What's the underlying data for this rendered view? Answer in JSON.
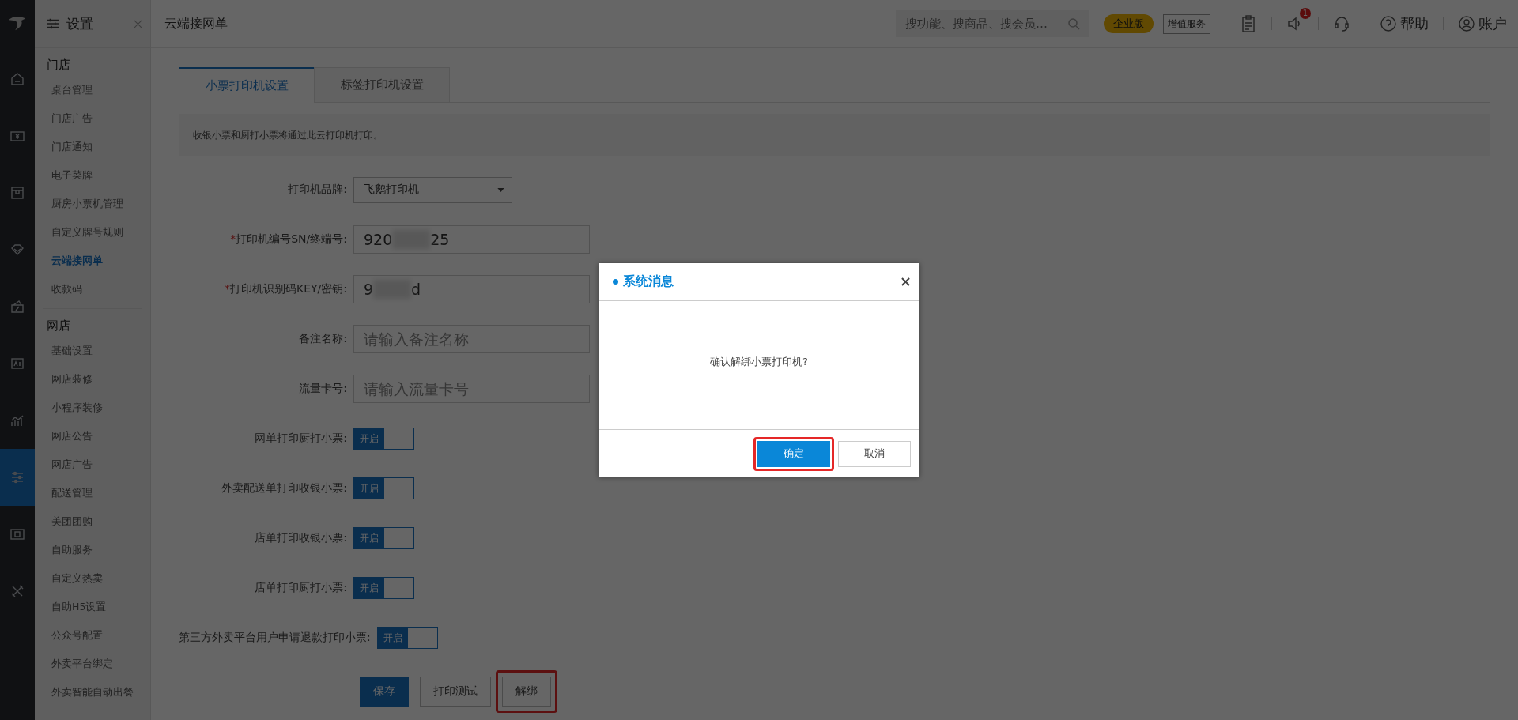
{
  "rail": [
    {
      "selected": false
    },
    {
      "selected": false
    },
    {
      "selected": false
    },
    {
      "selected": false
    },
    {
      "selected": false
    },
    {
      "selected": false
    },
    {
      "selected": false
    },
    {
      "selected": true
    },
    {
      "selected": false
    },
    {
      "selected": false
    }
  ],
  "sidebar": {
    "title": "设置",
    "groups": [
      {
        "name": "门店",
        "items": [
          {
            "label": "桌台管理",
            "selected": false
          },
          {
            "label": "门店广告",
            "selected": false
          },
          {
            "label": "门店通知",
            "selected": false
          },
          {
            "label": "电子菜牌",
            "selected": false
          },
          {
            "label": "厨房小票机管理",
            "selected": false
          },
          {
            "label": "自定义牌号规则",
            "selected": false
          },
          {
            "label": "云端接网单",
            "selected": true
          },
          {
            "label": "收款码",
            "selected": false
          }
        ]
      },
      {
        "name": "网店",
        "items": [
          {
            "label": "基础设置",
            "selected": false
          },
          {
            "label": "网店装修",
            "selected": false
          },
          {
            "label": "小程序装修",
            "selected": false
          },
          {
            "label": "网店公告",
            "selected": false
          },
          {
            "label": "网店广告",
            "selected": false
          },
          {
            "label": "配送管理",
            "selected": false
          },
          {
            "label": "美团团购",
            "selected": false
          },
          {
            "label": "自助服务",
            "selected": false
          },
          {
            "label": "自定义热卖",
            "selected": false
          },
          {
            "label": "自助H5设置",
            "selected": false
          },
          {
            "label": "公众号配置",
            "selected": false
          },
          {
            "label": "外卖平台绑定",
            "selected": false
          },
          {
            "label": "外卖智能自动出餐",
            "selected": false
          }
        ]
      }
    ]
  },
  "topbar": {
    "title": "云端接网单",
    "search": {
      "placeholder": "搜功能、搜商品、搜会员…"
    },
    "edition": "企业版",
    "value_added": "增值服务",
    "notification_count": "1",
    "help": "帮助",
    "account": "账户"
  },
  "tabs": [
    {
      "label": "小票打印机设置",
      "selected": true
    },
    {
      "label": "标签打印机设置",
      "selected": false
    }
  ],
  "notice": "收银小票和厨打小票将通过此云打印机打印。",
  "form": [
    {
      "kind": "select",
      "label": "打印机品牌:",
      "value": "飞鹅打印机"
    },
    {
      "kind": "masked",
      "label": "打印机编号SN/终端号:",
      "required_mark": "*",
      "value_start": "920",
      "value_end": "25"
    },
    {
      "kind": "masked",
      "label": "打印机识别码KEY/密钥:",
      "required_mark": "*",
      "value_start": "9",
      "value_end": "d"
    },
    {
      "kind": "input",
      "label": "备注名称:",
      "placeholder": "请输入备注名称"
    },
    {
      "kind": "input",
      "label": "流量卡号:",
      "placeholder": "请输入流量卡号"
    },
    {
      "kind": "toggle",
      "label": "网单打印厨打小票:",
      "on": true,
      "text": "开启"
    },
    {
      "kind": "toggle",
      "label": "外卖配送单打印收银小票:",
      "on": true,
      "text": "开启"
    },
    {
      "kind": "toggle",
      "label": "店单打印收银小票:",
      "on": true,
      "text": "开启"
    },
    {
      "kind": "toggle",
      "label": "店单打印厨打小票:",
      "on": true,
      "text": "开启"
    },
    {
      "kind": "toggle",
      "label": "第三方外卖平台用户申请退款打印小票:",
      "on": true,
      "text": "开启"
    }
  ],
  "actions": [
    {
      "label": "保存",
      "kind": "primary",
      "highlighted": false
    },
    {
      "label": "打印测试",
      "kind": "default",
      "highlighted": false
    },
    {
      "label": "解绑",
      "kind": "default",
      "highlighted": true
    }
  ],
  "dialog": {
    "title": "系统消息",
    "message": "确认解绑小票打印机?",
    "buttons": [
      {
        "label": "确定",
        "kind": "primary",
        "highlighted": true
      },
      {
        "label": "取消",
        "kind": "default",
        "highlighted": false
      }
    ]
  }
}
